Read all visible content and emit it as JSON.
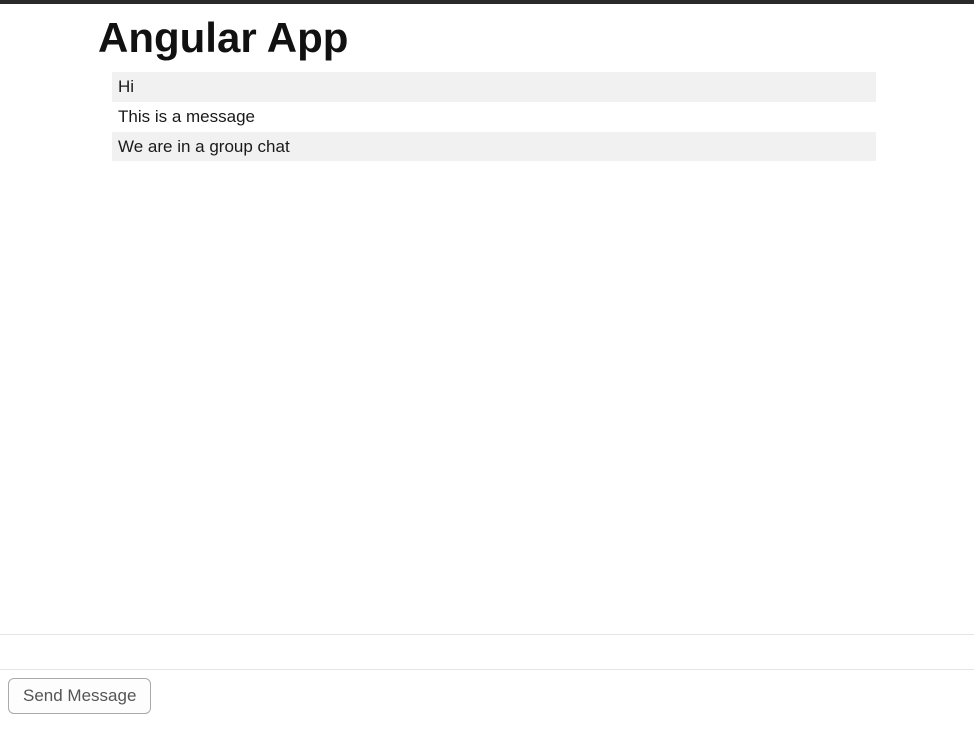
{
  "header": {
    "title": "Angular App"
  },
  "messages": [
    "Hi",
    "This is a message",
    "We are in a group chat"
  ],
  "composer": {
    "input_value": "",
    "send_label": "Send Message"
  }
}
